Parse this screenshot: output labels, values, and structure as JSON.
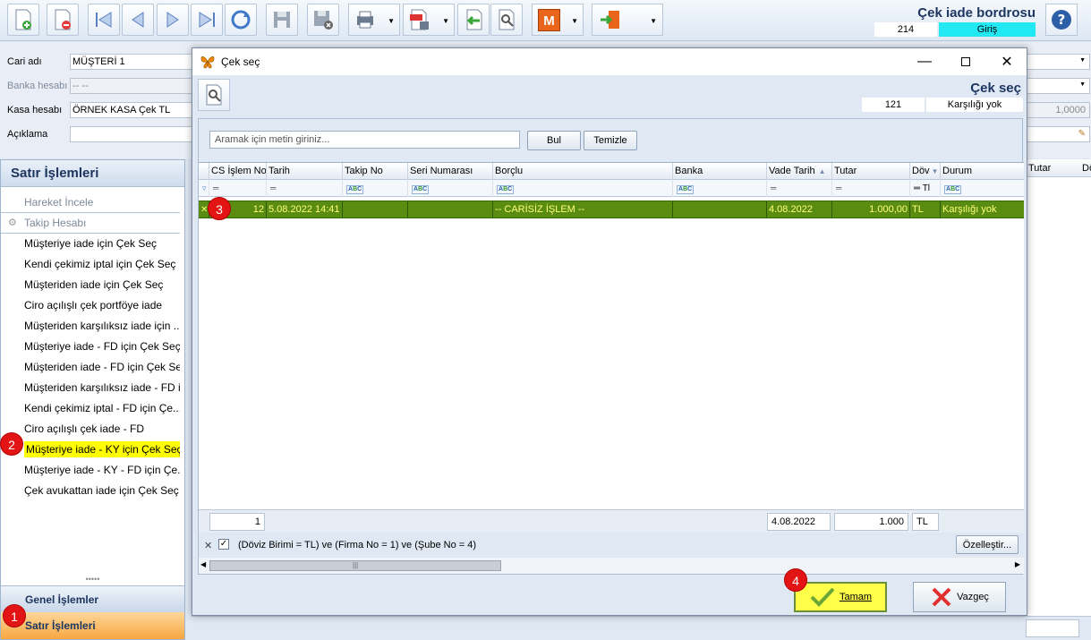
{
  "header": {
    "doc_title": "Çek iade bordrosu",
    "doc_no": "214",
    "doc_state": "Giriş"
  },
  "form": {
    "cari_label": "Cari adı",
    "cari_value": "MÜŞTERİ 1",
    "banka_label": "Banka hesabı",
    "banka_value": "-- --",
    "kasa_label": "Kasa hesabı",
    "kasa_value": "ÖRNEK KASA Çek TL",
    "aciklama_label": "Açıklama",
    "rate_value": "1,0000"
  },
  "left_panel": {
    "title": "Satır İşlemleri",
    "items": [
      {
        "label": "Hareket İncele"
      },
      {
        "label": "Takip Hesabı"
      },
      {
        "label": "Müşteriye iade için Çek Seç"
      },
      {
        "label": "Kendi çekimiz iptal için Çek Seç"
      },
      {
        "label": "Müşteriden iade için Çek Seç"
      },
      {
        "label": "Ciro açılışlı çek portföye iade"
      },
      {
        "label": "Müşteriden karşılıksız iade için ..."
      },
      {
        "label": "Müşteriye iade - FD için Çek Seç"
      },
      {
        "label": "Müşteriden iade - FD için Çek Seç"
      },
      {
        "label": "Müşteriden karşılıksız iade - FD i..."
      },
      {
        "label": "Kendi çekimiz iptal - FD için Çe..."
      },
      {
        "label": "Ciro açılışlı çek iade - FD"
      },
      {
        "label": "Müşteriye iade - KY için Çek Seç"
      },
      {
        "label": "Müşteriye iade - KY - FD için Çe..."
      },
      {
        "label": "Çek avukattan iade için Çek Seç"
      }
    ],
    "section_general": "Genel İşlemler",
    "section_line": "Satır İşlemleri"
  },
  "background_grid": {
    "col_tutar": "Tutar",
    "col_d": "Dö"
  },
  "dialog": {
    "window_title": "Çek seç",
    "big_title": "Çek seç",
    "no": "121",
    "state": "Karşılığı yok",
    "search_placeholder": "Aramak için metin giriniz...",
    "find_label": "Bul",
    "clear_label": "Temizle",
    "columns": {
      "islem_no": "CS İşlem No",
      "tarih": "Tarih",
      "takip_no": "Takip No",
      "seri": "Seri Numarası",
      "borclu": "Borçlu",
      "banka": "Banka",
      "vade": "Vade Tarih",
      "tutar": "Tutar",
      "doviz": "Döv",
      "durum": "Durum"
    },
    "filter_row": {
      "doviz": "Tl"
    },
    "row": {
      "islem_no": "12",
      "tarih": "5.08.2022 14:41",
      "takip_no": "",
      "seri": "",
      "borclu": "-- CARİSİZ İŞLEM --",
      "banka": "",
      "vade": "4.08.2022",
      "tutar": "1.000,00",
      "doviz": "TL",
      "durum": "Karşılığı yok"
    },
    "footer": {
      "count": "1",
      "vade": "4.08.2022",
      "tutar": "1.000",
      "doviz": "TL"
    },
    "filter_text": "(Döviz Birimi = TL) ve (Firma No = 1) ve (Şube No = 4)",
    "customize_label": "Özelleştir...",
    "ok_label": "Tamam",
    "cancel_label": "Vazgeç"
  },
  "badges": [
    "1",
    "2",
    "3",
    "4"
  ],
  "colors": {
    "selected_row": "#5a8c12",
    "highlight": "#ffff00",
    "state_cyan": "#22e8f4",
    "badge": "#e31414"
  }
}
